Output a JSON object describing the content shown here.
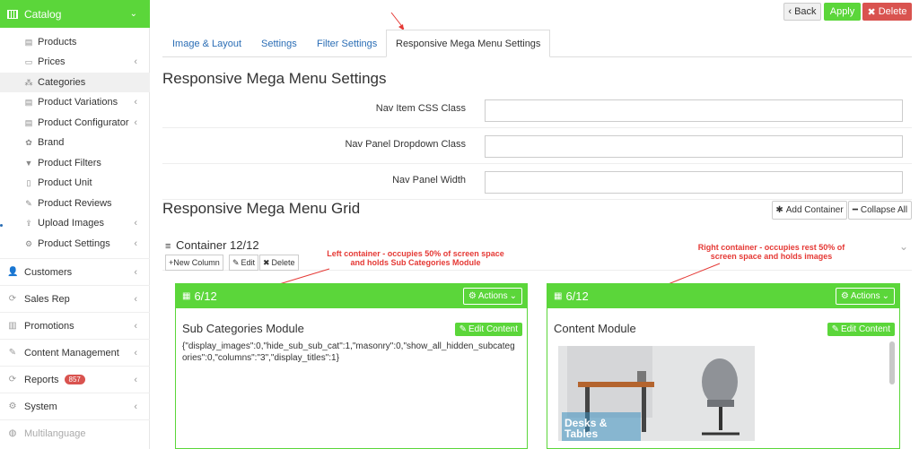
{
  "sidebar": {
    "header": "Catalog",
    "sub_items": [
      {
        "label": "Products",
        "icon": "list-icon"
      },
      {
        "label": "Prices",
        "icon": "money-icon",
        "arrow": true
      },
      {
        "label": "Categories",
        "icon": "sitemap-icon",
        "active": true
      },
      {
        "label": "Product Variations",
        "icon": "list-icon",
        "arrow": true
      },
      {
        "label": "Product Configurator",
        "icon": "list-icon",
        "arrow": true
      },
      {
        "label": "Brand",
        "icon": "star-icon"
      },
      {
        "label": "Product Filters",
        "icon": "filter-icon"
      },
      {
        "label": "Product Unit",
        "icon": "file-icon"
      },
      {
        "label": "Product Reviews",
        "icon": "edit-icon"
      },
      {
        "label": "Upload Images",
        "icon": "upload-icon",
        "arrow": true
      },
      {
        "label": "Product Settings",
        "icon": "gear-icon",
        "arrow": true
      }
    ],
    "main_items": [
      {
        "label": "Customers",
        "icon": "user-icon"
      },
      {
        "label": "Sales Rep",
        "icon": "refresh-icon"
      },
      {
        "label": "Promotions",
        "icon": "chart-icon"
      },
      {
        "label": "Content Management",
        "icon": "edit-icon"
      },
      {
        "label": "Reports",
        "icon": "refresh-icon",
        "badge": "857"
      },
      {
        "label": "System",
        "icon": "gears-icon"
      },
      {
        "label": "Multilanguage",
        "icon": "globe-icon"
      }
    ]
  },
  "toolbar": {
    "back": "Back",
    "apply": "Apply",
    "delete": "Delete"
  },
  "tabs": [
    "Image & Layout",
    "Settings",
    "Filter Settings",
    "Responsive Mega Menu Settings"
  ],
  "settings": {
    "title": "Responsive Mega Menu Settings",
    "fields": [
      {
        "label": "Nav Item CSS Class",
        "value": ""
      },
      {
        "label": "Nav Panel Dropdown Class",
        "value": ""
      },
      {
        "label": "Nav Panel Width",
        "value": ""
      }
    ]
  },
  "grid": {
    "title": "Responsive Mega Menu Grid",
    "add_container": "Add Container",
    "collapse_all": "Collapse All",
    "container_title": "Container 12/12",
    "new_column": "New Column",
    "edit": "Edit",
    "delete": "Delete"
  },
  "panels": [
    {
      "size": "6/12",
      "actions": "Actions",
      "module_title": "Sub Categories Module",
      "edit_content": "Edit Content",
      "content": "{\"display_images\":0,\"hide_sub_sub_cat\":1,\"masonry\":0,\"show_all_hidden_subcategories\":0,\"columns\":\"3\",\"display_titles\":1}"
    },
    {
      "size": "6/12",
      "actions": "Actions",
      "module_title": "Content Module",
      "edit_content": "Edit Content",
      "image_caption": "Desks & Tables"
    }
  ],
  "annotations": {
    "left": "Left container - occupies 50% of screen space and holds Sub Categories Module",
    "right": "Right container - occupies rest 50% of screen space and holds images"
  },
  "colors": {
    "accent": "#5bd63a",
    "danger": "#d9534f",
    "link": "#2a6db5",
    "annotation": "#e53935"
  }
}
